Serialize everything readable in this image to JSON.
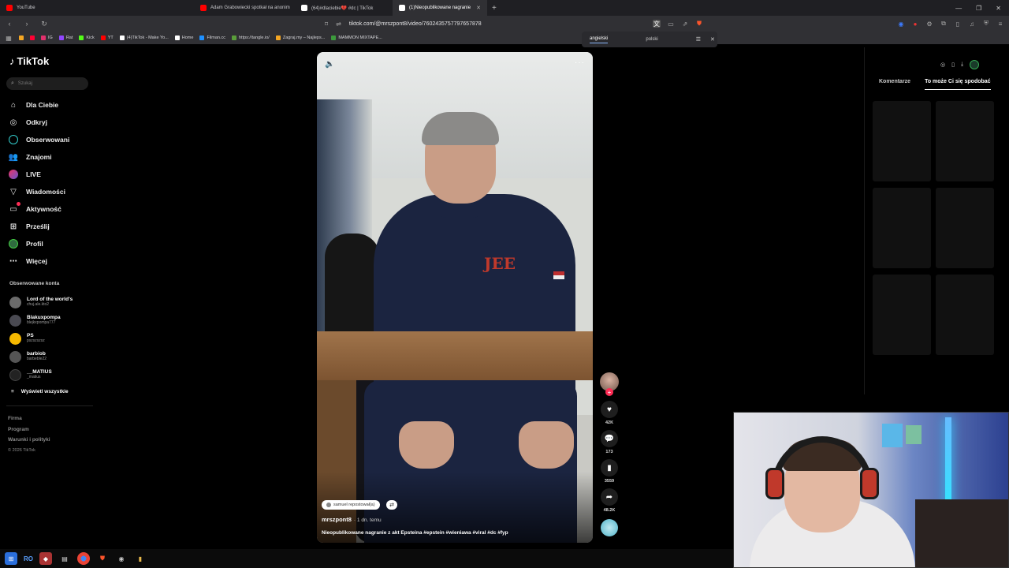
{
  "browser": {
    "tabs": [
      {
        "label": "YouTube",
        "color": "#ff0000",
        "active": false
      },
      {
        "label": "Adam Grabowiecki spotkał na anonim",
        "color": "#ff0000",
        "active": false
      },
      {
        "label": "(64)#dlaciebie💔 #dc | TikTok",
        "color": "#ffffff",
        "active": false
      },
      {
        "label": "(1)Nieopublikowane nagranie",
        "color": "#ffffff",
        "active": true
      }
    ],
    "url": "tiktok.com/@mrszpont8/video/7602435757797657878",
    "bookmarks": [
      {
        "label": "",
        "color": "#f4a623"
      },
      {
        "label": "",
        "color": "#ff0033"
      },
      {
        "label": "IG",
        "color": "#e1306c"
      },
      {
        "label": "Rat",
        "color": "#9146ff"
      },
      {
        "label": "Kick",
        "color": "#53fc18"
      },
      {
        "label": "YT",
        "color": "#ff0000"
      },
      {
        "label": "(4)TikTok - Make Yo...",
        "color": "#ffffff"
      },
      {
        "label": "Home",
        "color": "#ffffff"
      },
      {
        "label": "Filman.cc",
        "color": "#1e90ff"
      },
      {
        "label": "https://tangle.io/",
        "color": "#5a9e3a"
      },
      {
        "label": "Zagraj.my – Najleps...",
        "color": "#f4a623"
      },
      {
        "label": "MAMMON MIXTAPE...",
        "color": "#3c9a3c"
      }
    ],
    "translate": {
      "from": "angielski",
      "to": "polski"
    }
  },
  "sidebar": {
    "logo": "TikTok",
    "search_placeholder": "Szukaj",
    "nav": [
      {
        "label": "Dla Ciebie",
        "icon": "home-icon"
      },
      {
        "label": "Odkryj",
        "icon": "compass-icon"
      },
      {
        "label": "Obserwowani",
        "icon": "following-icon"
      },
      {
        "label": "Znajomi",
        "icon": "friends-icon"
      },
      {
        "label": "LIVE",
        "icon": "live-icon"
      },
      {
        "label": "Wiadomości",
        "icon": "messages-icon"
      },
      {
        "label": "Aktywność",
        "icon": "activity-icon"
      },
      {
        "label": "Prześlij",
        "icon": "upload-icon"
      },
      {
        "label": "Profil",
        "icon": "profile-icon"
      },
      {
        "label": "Więcej",
        "icon": "more-icon"
      }
    ],
    "followed_title": "Obserwowane konta",
    "followed": [
      {
        "name": "Lord of the world's",
        "handle": "chuj.ale.kto2",
        "color": "#6b6b6b"
      },
      {
        "name": "Blakuxpompa",
        "handle": "blejkxpompa777",
        "color": "#4a4a52"
      },
      {
        "name": "PS",
        "handle": "pszszszsz",
        "color": "#f5b800"
      },
      {
        "name": "barbiob",
        "handle": "barbeble22",
        "color": "#555"
      },
      {
        "name": "__MATIUS",
        "handle": "_matius",
        "color": "#222"
      }
    ],
    "show_all": "Wyświetl wszystkie",
    "footer": [
      "Firma",
      "Program",
      "Warunki i polityki"
    ],
    "copyright": "© 2026 TikTok"
  },
  "video": {
    "repost_label": "samuel repostował(a)",
    "author": "mrszpont8",
    "posted_ago": "· 1 dn. temu",
    "caption": "Nieopublikowane nagranie z akt Epsteina #epstein #wieniawa #viral #dc #fyp",
    "monogram": "JEE",
    "counts": {
      "likes": "42K",
      "comments": "173",
      "saves": "3559",
      "shares": "48.2K"
    }
  },
  "right_panel": {
    "tabs": [
      "Komentarze",
      "To może Ci się spodobać"
    ],
    "active_tab": 1
  },
  "taskbar": {
    "label": "RO"
  }
}
